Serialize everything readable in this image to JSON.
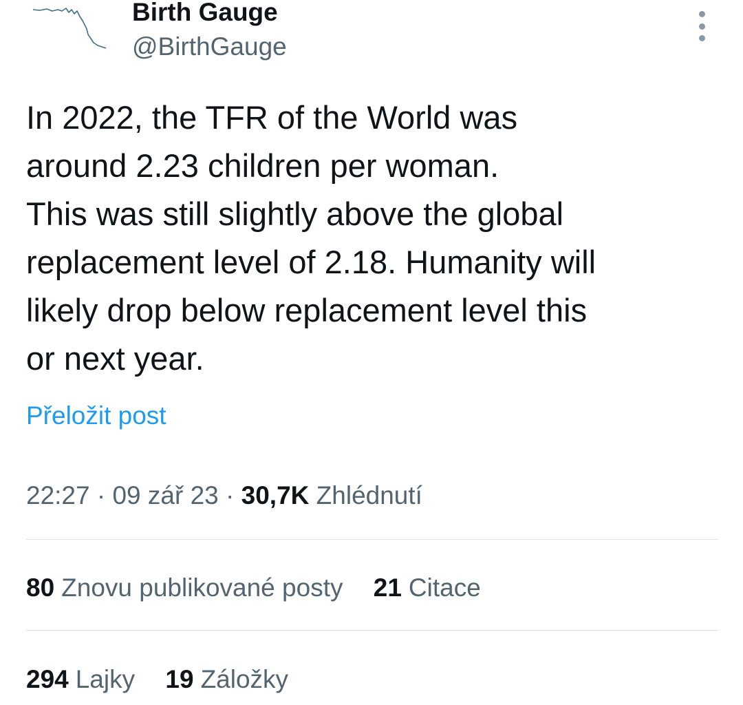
{
  "author": {
    "display_name": "Birth Gauge",
    "handle": "@BirthGauge",
    "avatar_icon": "declining-line-chart-icon"
  },
  "menu_icon": "more-options-icon",
  "tweet": {
    "text": "In 2022, the TFR of the World was\naround 2.23 children per woman.\nThis was still slightly above the global\nreplacement level of 2.18. Humanity will\nlikely drop below replacement level this\nor next year.",
    "translate_label": "Přeložit post"
  },
  "meta": {
    "time": "22:27",
    "date": "09 zář 23",
    "views_count": "30,7K",
    "views_label": "Zhlédnutí"
  },
  "stats": {
    "reposts_count": "80",
    "reposts_label": "Znovu publikované posty",
    "quotes_count": "21",
    "quotes_label": "Citace",
    "likes_count": "294",
    "likes_label": "Lajky",
    "bookmarks_count": "19",
    "bookmarks_label": "Záložky"
  },
  "colors": {
    "text_primary": "#0f1419",
    "text_secondary": "#536471",
    "link": "#1d9bf0",
    "divider": "#dfe3e6"
  }
}
